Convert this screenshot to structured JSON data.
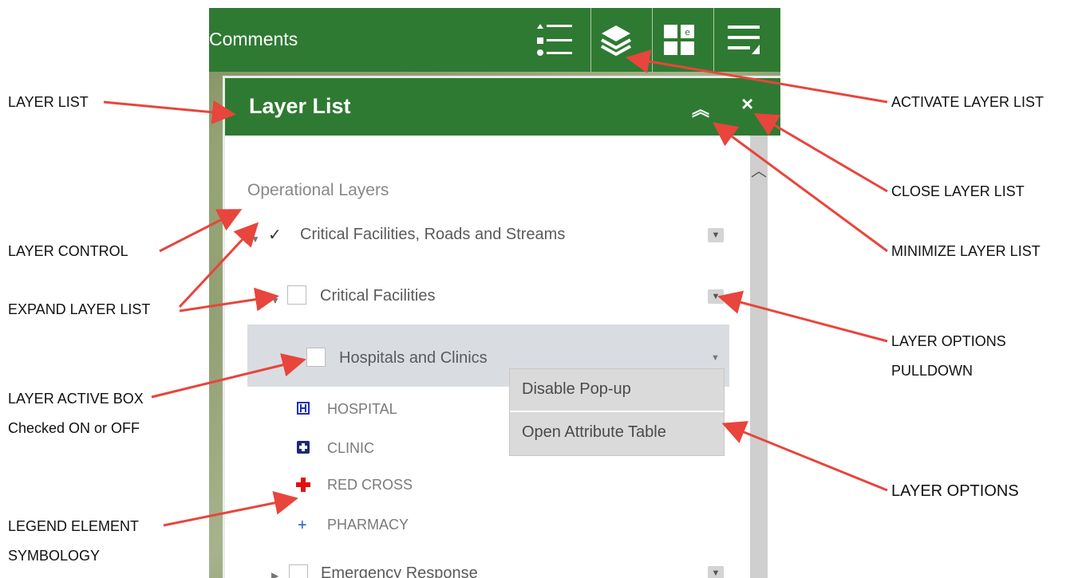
{
  "app": {
    "title": "Comments"
  },
  "panel": {
    "title": "Layer List",
    "section": "Operational Layers",
    "layers": [
      {
        "label": "Critical Facilities, Roads and Streams",
        "checked": "✓"
      },
      {
        "label": "Critical Facilities"
      },
      {
        "label": "Hospitals and Clinics"
      },
      {
        "label": "Emergency Response"
      }
    ],
    "legend": [
      {
        "label": "HOSPITAL",
        "icon": "hospital-icon"
      },
      {
        "label": "CLINIC",
        "icon": "clinic-icon"
      },
      {
        "label": "RED CROSS",
        "icon": "red-cross-icon"
      },
      {
        "label": "PHARMACY",
        "icon": "pharmacy-icon"
      }
    ],
    "menu": [
      "Disable Pop-up",
      "Open Attribute Table"
    ]
  },
  "annotations": {
    "layer_list": "LAYER LIST",
    "layer_control": "LAYER CONTROL",
    "expand_layer_list": "EXPAND LAYER LIST",
    "layer_active_box_1": "LAYER ACTIVE BOX",
    "layer_active_box_2": "Checked ON or OFF",
    "legend_element_1": "LEGEND ELEMENT",
    "legend_element_2": "SYMBOLOGY",
    "activate_layer_list": "ACTIVATE LAYER LIST",
    "close_layer_list": "CLOSE LAYER LIST",
    "minimize_layer_list": "MINIMIZE LAYER LIST",
    "layer_options_pulldown_1": "LAYER OPTIONS",
    "layer_options_pulldown_2": "PULLDOWN",
    "layer_options": "LAYER OPTIONS"
  },
  "colors": {
    "header_green": "#2f7a32",
    "arrow_red": "#e8453c"
  }
}
